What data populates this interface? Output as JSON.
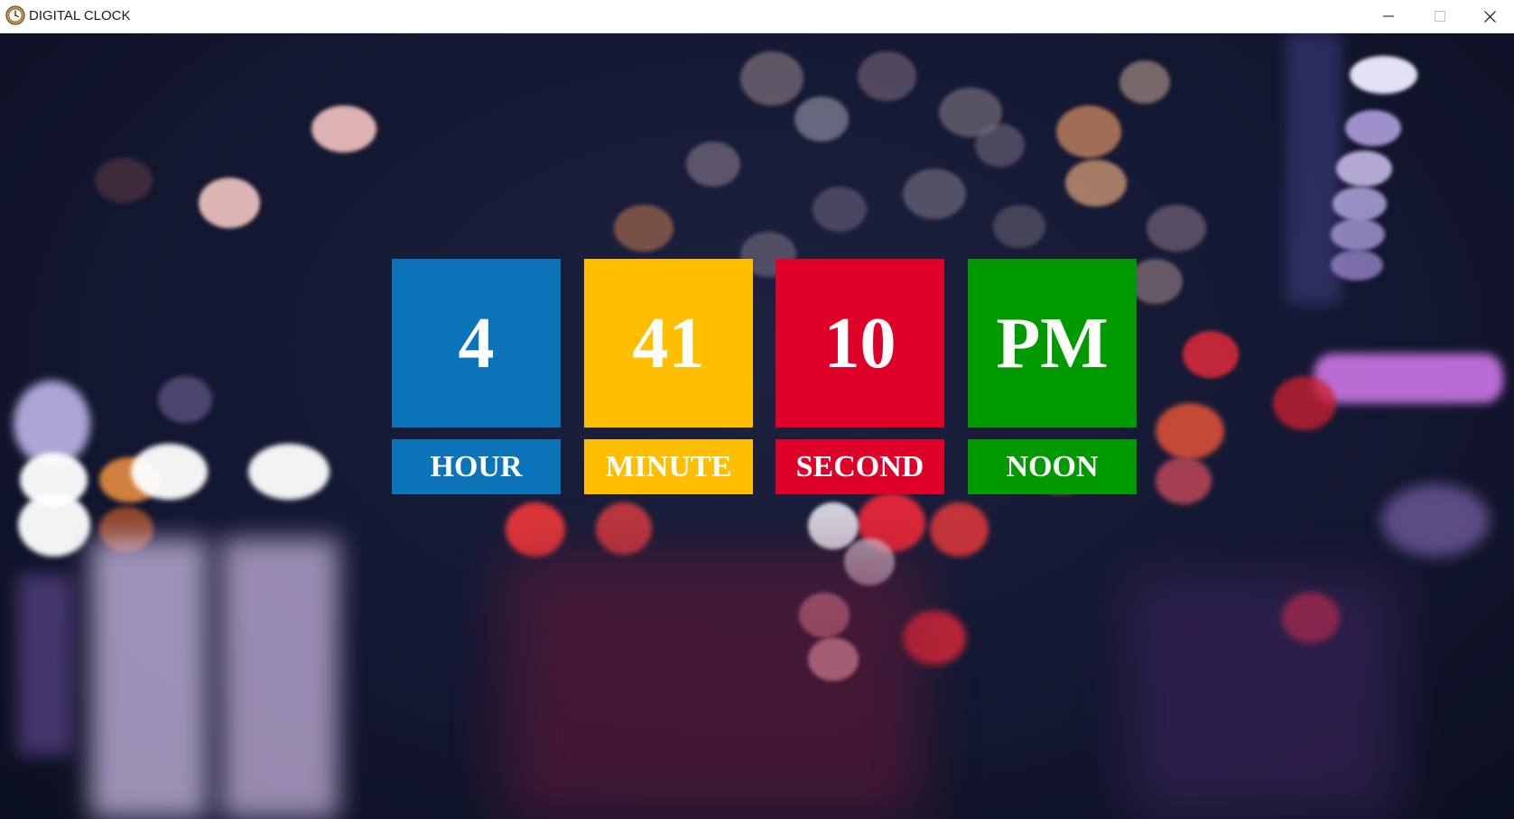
{
  "window": {
    "title": "DIGITAL CLOCK",
    "app_icon": "clock-icon",
    "controls": {
      "minimize_icon": "minimize-icon",
      "maximize_icon": "maximize-icon",
      "close_icon": "close-icon"
    }
  },
  "clock": {
    "hour": {
      "value": "4",
      "label": "HOUR",
      "color": "#0b74b9"
    },
    "minute": {
      "value": "41",
      "label": "MINUTE",
      "color": "#ffbf00"
    },
    "second": {
      "value": "10",
      "label": "SECOND",
      "color": "#df0029"
    },
    "noon": {
      "value": "PM",
      "label": "NOON",
      "color": "#009a00"
    }
  },
  "background": {
    "description_icon": "bokeh-city-lights-background"
  }
}
